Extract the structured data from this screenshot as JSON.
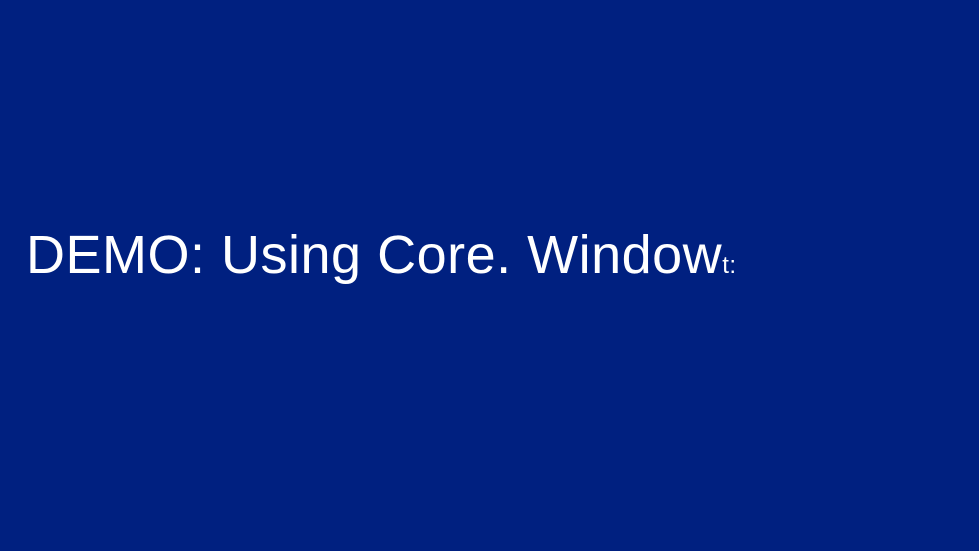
{
  "slide": {
    "title_main": "DEMO: Using Core. Window",
    "title_suffix": "t:"
  }
}
